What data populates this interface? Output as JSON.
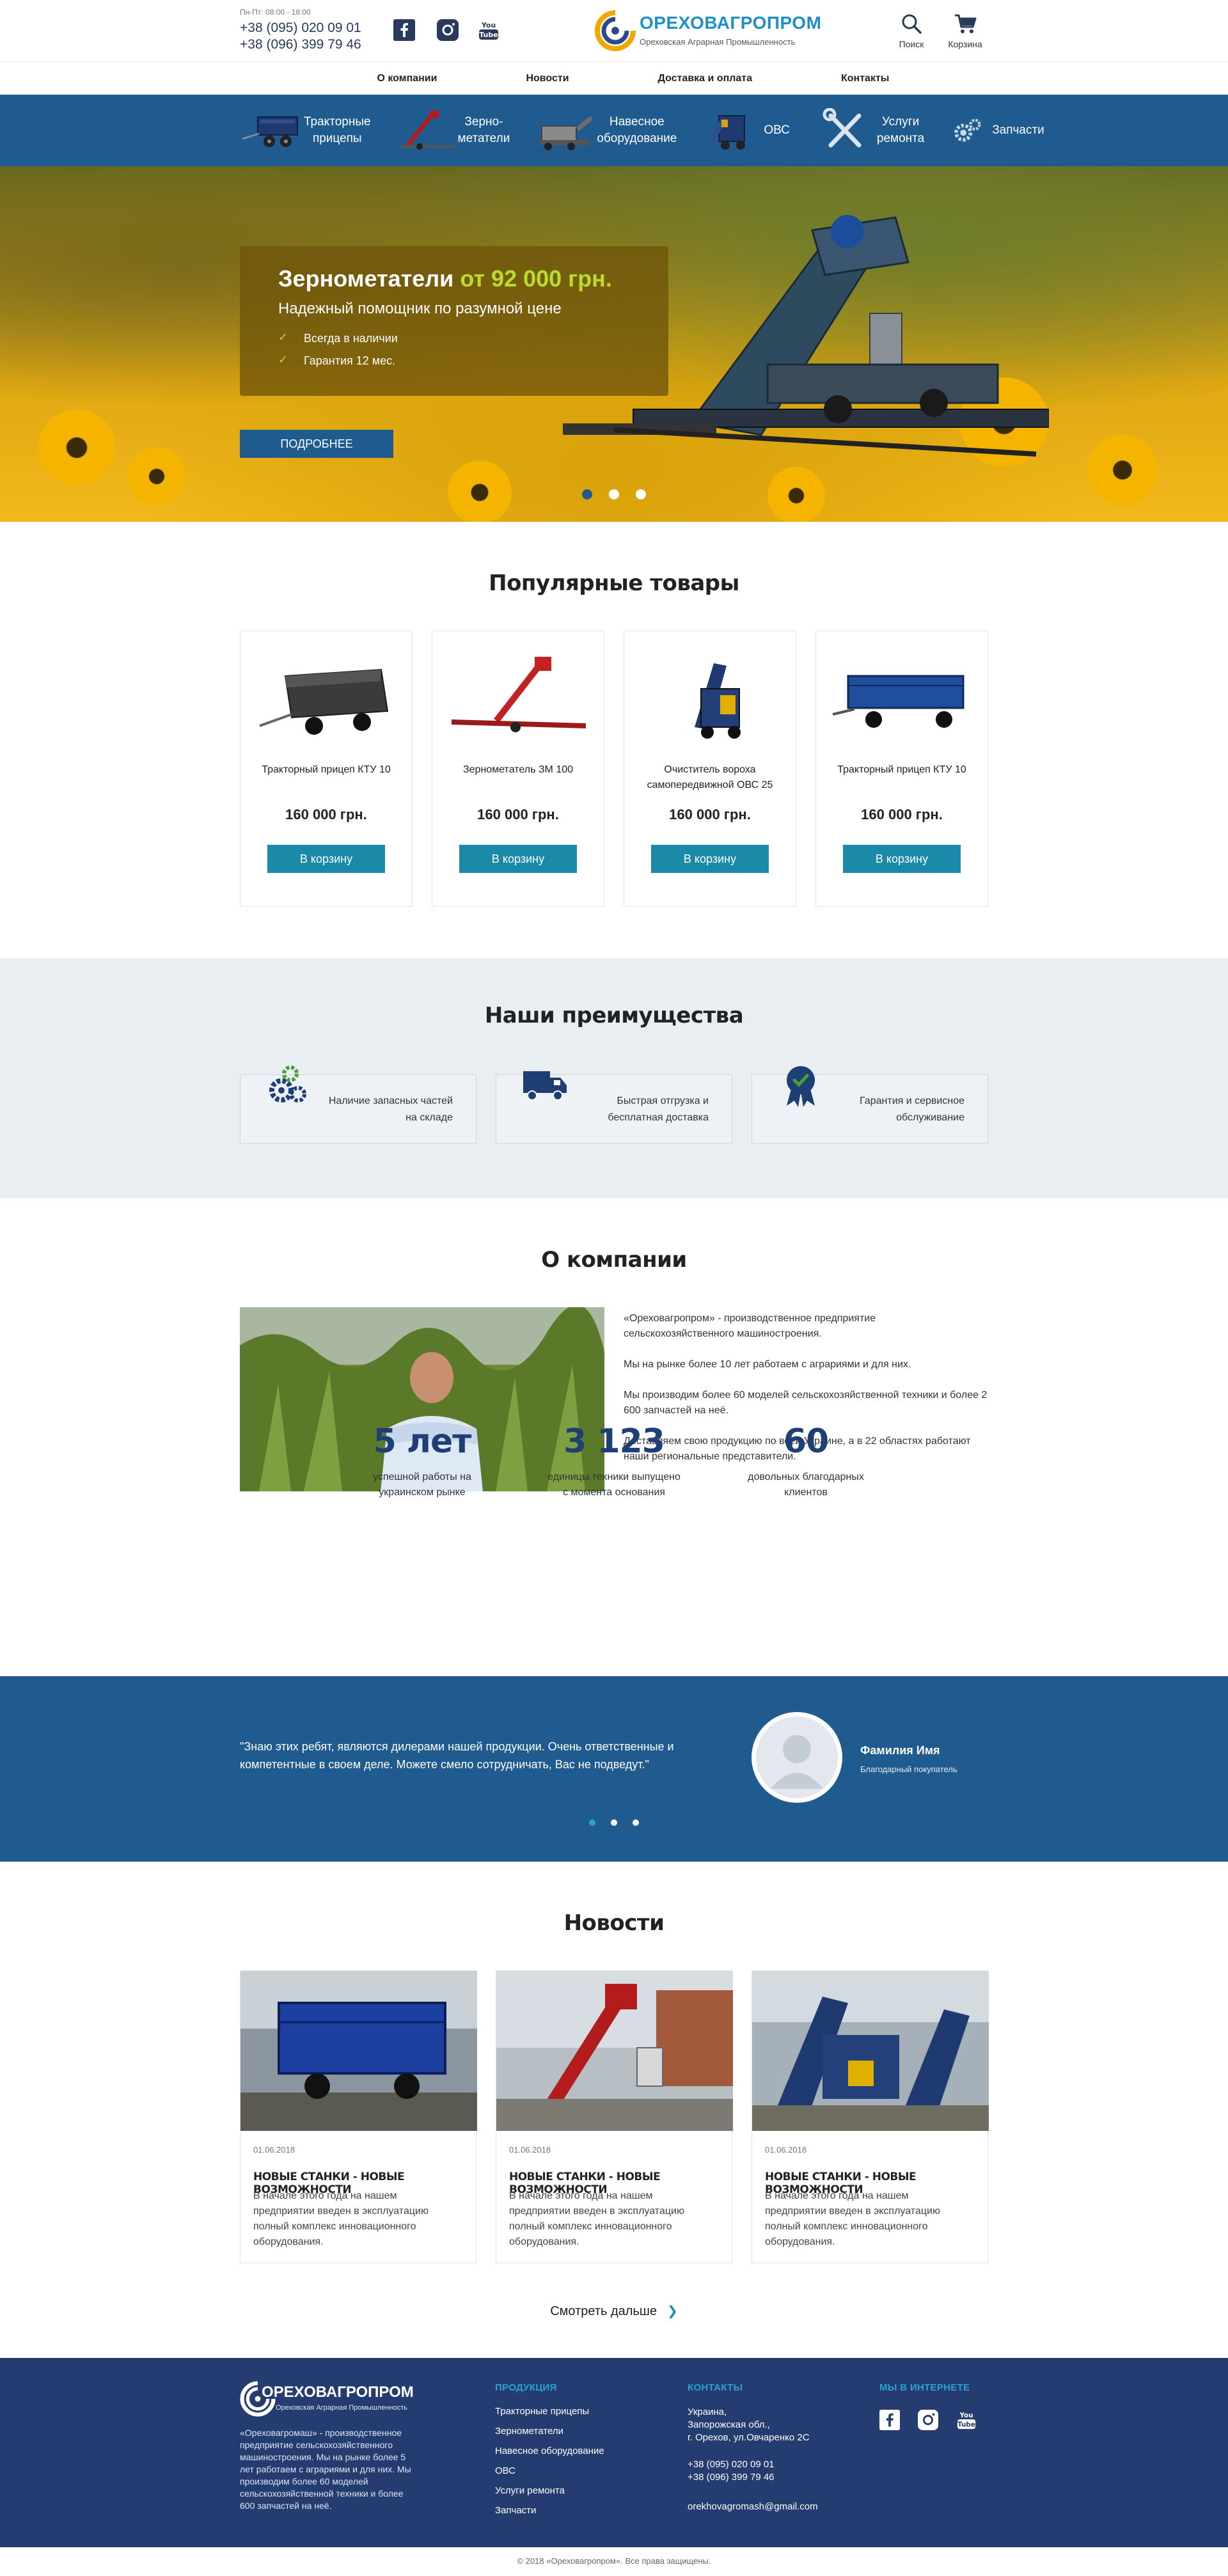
{
  "header": {
    "hours": "Пн-Пт: 08:00 - 18:00",
    "phone1": "+38 (095) 020 09 01",
    "phone2": "+38 (096) 399 79 46",
    "logo_name": "ОРЕХОВАГРОПРОМ",
    "logo_sub": "Ореховская Аграрная Промышленность",
    "search_label": "Поиск",
    "cart_label": "Корзина"
  },
  "menu": [
    "О компании",
    "Новости",
    "Доставка и оплата",
    "Контакты"
  ],
  "categories": [
    {
      "label1": "Тракторные",
      "label2": "прицепы"
    },
    {
      "label1": "Зерно-",
      "label2": "метатели"
    },
    {
      "label1": "Навесное",
      "label2": "оборудование"
    },
    {
      "label1": "ОВС",
      "label2": ""
    },
    {
      "label1": "Услуги",
      "label2": "ремонта"
    },
    {
      "label1": "Запчасти",
      "label2": ""
    }
  ],
  "hero": {
    "title": "Зернометатели",
    "price": "от 92 000 грн.",
    "subtitle": "Надежный помощник по разумной цене",
    "bullets": [
      "Всегда в наличии",
      "Гарантия 12 мес."
    ],
    "button": "ПОДРОБНЕЕ"
  },
  "products": {
    "title": "Популярные товары",
    "items": [
      {
        "name": "Тракторный прицеп КТУ 10",
        "price": "160 000 грн.",
        "button": "В корзину"
      },
      {
        "name": "Зернометатель ЗМ 100",
        "price": "160 000 грн.",
        "button": "В корзину"
      },
      {
        "name": "Очиститель вороха самопередвижной ОВС 25",
        "price": "160 000 грн.",
        "button": "В корзину"
      },
      {
        "name": "Тракторный прицеп КТУ 10",
        "price": "160 000 грн.",
        "button": "В корзину"
      }
    ]
  },
  "advantages": {
    "title": "Наши преимущества",
    "items": [
      {
        "text": "Наличие запасных частей на складе",
        "icon": "gears-icon"
      },
      {
        "text": "Быстрая отгрузка и бесплатная доставка",
        "icon": "truck-icon"
      },
      {
        "text": "Гарантия и сервисное обслуживание",
        "icon": "badge-icon"
      }
    ]
  },
  "about": {
    "title": "О компании",
    "p1": "«Ореховагропром» - производственное предприятие сельскохозяйственного машиностроения.",
    "p2": "Мы на рынке более 10 лет работаем с аграриями и для них.",
    "p3": "Мы производим более 60 моделей сельскохозяйственной техники и более 2 600 запчастей на неё.",
    "p4": "Доставляем свою продукцию по всей Украине, а в 22 областях работают наши региональные представители.",
    "stats": [
      {
        "num": "5 лет",
        "label": "успешной работы на украинском рынке"
      },
      {
        "num": "3 123",
        "label": "единицы техники выпущено с момента основания"
      },
      {
        "num": "60",
        "label": "довольных благодарных клиентов"
      }
    ]
  },
  "testimonial": {
    "quote": "\"Знаю этих ребят, являются дилерами нашей продукции. Очень ответственные и компетентные в своем деле. Можете смело сотрудничать, Вас не подведут.\"",
    "name": "Фамилия Имя",
    "role": "Благодарный покупатель"
  },
  "news": {
    "title": "Новости",
    "items": [
      {
        "date": "01.06.2018",
        "title": "НОВЫЕ СТАНКИ - НОВЫЕ ВОЗМОЖНОСТИ",
        "text": "В начале этого года на нашем предприятии введен в эксплуатацию полный комплекс инновационного оборудования."
      },
      {
        "date": "01.06.2018",
        "title": "НОВЫЕ СТАНКИ - НОВЫЕ ВОЗМОЖНОСТИ",
        "text": "В начале этого года на нашем предприятии введен в эксплуатацию полный комплекс инновационного оборудования."
      },
      {
        "date": "01.06.2018",
        "title": "НОВЫЕ СТАНКИ - НОВЫЕ ВОЗМОЖНОСТИ",
        "text": "В начале этого года на нашем предприятии введен в эксплуатацию полный комплекс инновационного оборудования."
      }
    ],
    "more": "Смотреть дальше"
  },
  "footer": {
    "about": "«Ореховагромаш» - производственное предприятие сельскохозяйственного машиностроения. Мы на рынке более 5 лет работаем с аграриями и для них. Мы производим более 60 моделей сельскохозяйственной техники и более 600 запчастей на неё.",
    "products_title": "ПРОДУКЦИЯ",
    "products": [
      "Тракторные прицепы",
      "Зернометатели",
      "Навесное оборудование",
      "ОВС",
      "Услуги ремонта",
      "Запчасти"
    ],
    "contacts_title": "КОНТАКТЫ",
    "address1": "Украина,",
    "address2": "Запорожская обл.,",
    "address3": "г. Орехов, ул.Овчаренко 2С",
    "phone1": "+38 (095) 020 09 01",
    "phone2": "+38 (096) 399 79 46",
    "email": "orekhovagromash@gmail.com",
    "social_title": "МЫ В ИНТЕРНЕТЕ",
    "copyright": "© 2018 «Ореховагропром». Все права защищены."
  },
  "colors": {
    "brand_blue": "#1f5b8f",
    "button_teal": "#1a8aa8",
    "footer_navy": "#243c70",
    "accent_green": "#b9dc2d"
  }
}
